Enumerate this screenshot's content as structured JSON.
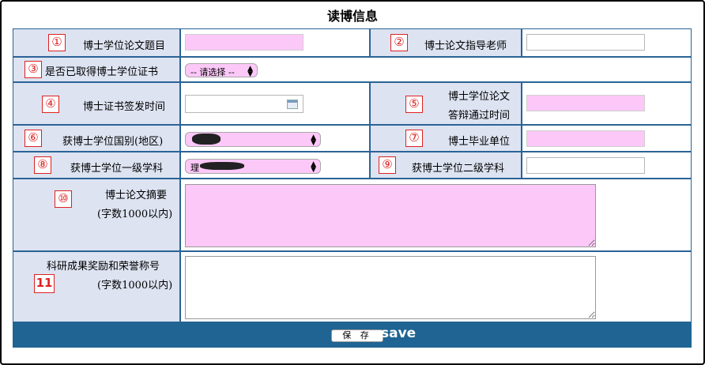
{
  "title": "读博信息",
  "badges": [
    "①",
    "②",
    "③",
    "④",
    "⑤",
    "⑥",
    "⑦",
    "⑧",
    "⑨",
    "⑩",
    "11"
  ],
  "labels": {
    "thesis_title": "博士学位论文题目",
    "advisor": "博士论文指导老师",
    "obtained_cert": "是否已取得博士学位证书",
    "cert_date": "博士证书签发时间",
    "defense_line1": "博士学位论文",
    "defense_line2": "答辩通过时间",
    "country": "获博士学位国别(地区)",
    "grad_unit": "博士毕业单位",
    "first_discipline": "获博士学位一级学科",
    "second_discipline": "获博士学位二级学科",
    "abstract_line1": "博士论文摘要",
    "abstract_line2": "(字数1000以内)",
    "awards_line1": "科研成果奖励和荣誉称号",
    "awards_line2": "(字数1000以内)"
  },
  "selects": {
    "obtained_cert": "-- 请选择 --",
    "first_discipline_partial": "理"
  },
  "footer": {
    "save_button": "保 存",
    "save_text": "save"
  }
}
